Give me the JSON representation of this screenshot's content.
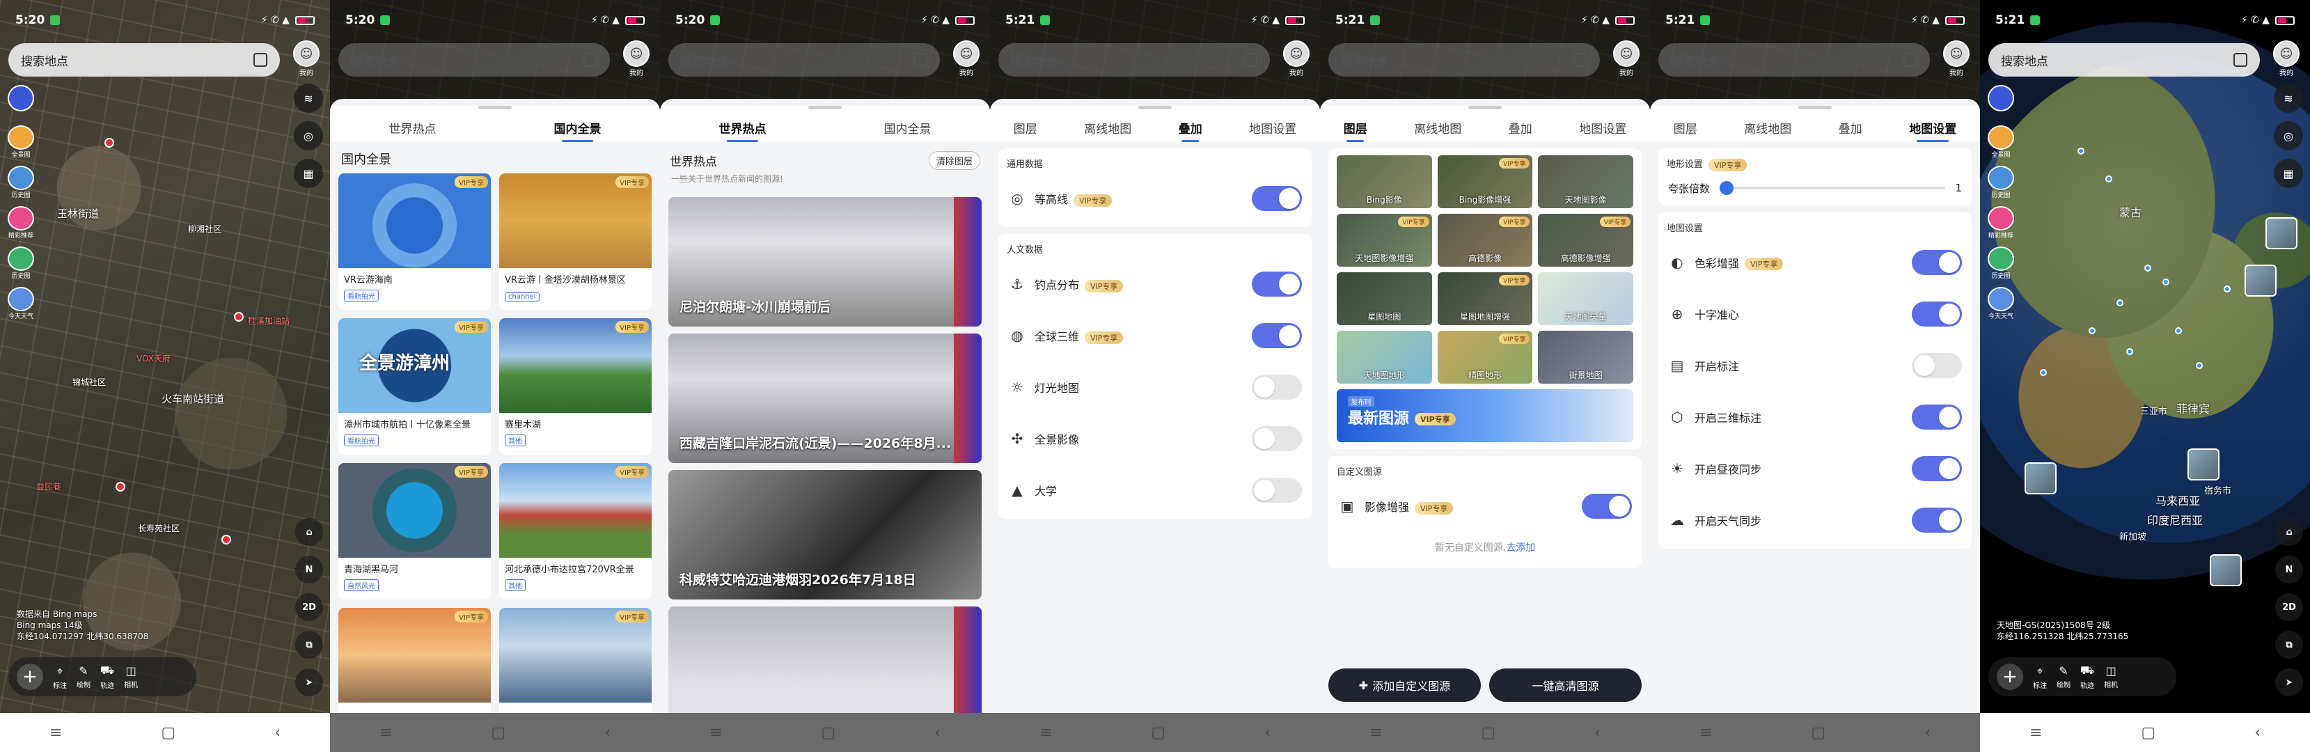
{
  "status": {
    "times": [
      "5:20",
      "5:20",
      "5:20",
      "5:21",
      "5:21",
      "5:21",
      "5:21"
    ]
  },
  "map": {
    "search_placeholder": "搜索地点",
    "avatar_label": "我的",
    "left_items": [
      "",
      "全景图",
      "历史图",
      "精彩推荐",
      "历史图",
      "今天天气"
    ],
    "right_items": [
      "图层",
      "探索",
      "工具"
    ],
    "right_bottom": [
      "2D",
      "图层",
      "定位"
    ],
    "labels_screen1": {
      "l1": "玉林街道",
      "l2": "柳湘社区",
      "l3": "火车南站街道",
      "l4": "锦城社区",
      "l5": "长寿苑社区",
      "l6": "桂溪加油站",
      "l7": "益民巷",
      "l8": "VOX天府"
    },
    "copyright1": [
      "数据来自 Bing maps",
      "Bing maps  14级",
      "东经104.071297  北纬30.638708"
    ],
    "tools": [
      {
        "label": "标注",
        "icon": "pin-icon"
      },
      {
        "label": "绘制",
        "icon": "draw-icon"
      },
      {
        "label": "轨迹",
        "icon": "track-icon"
      },
      {
        "label": "相机",
        "icon": "camera-icon"
      }
    ]
  },
  "panel_pano": {
    "tabs": [
      "世界热点",
      "国内全景"
    ],
    "active_tab": 1,
    "section": "国内全景",
    "vip": "VIP专享",
    "cards": [
      {
        "title": "VR云游海南",
        "tag": "看航拍光"
      },
      {
        "title": "VR云游丨金塔沙漠胡杨林景区",
        "tag": "channel"
      },
      {
        "title": "漳州市城市航拍丨十亿像素全景",
        "tag": "看航拍光"
      },
      {
        "title": "赛里木湖",
        "tag": "其他"
      },
      {
        "title": "青海湖黑马河",
        "tag": "自然风光"
      },
      {
        "title": "河北承德小布达拉宫720VR全景",
        "tag": "其他"
      },
      {
        "title": "",
        "tag": ""
      },
      {
        "title": "",
        "tag": ""
      }
    ],
    "card3_overlay": "全景游漳州"
  },
  "panel_hot": {
    "tabs": [
      "世界热点",
      "国内全景"
    ],
    "active_tab": 0,
    "title": "世界热点",
    "clear": "清除图层",
    "subtitle": "一些关于世界热点新闻的图源!",
    "items": [
      "尼泊尔朗塘-冰川崩塌前后",
      "西藏吉隆口岸泥石流(近景)——2026年8月...",
      "科威特艾哈迈迪港烟羽2026年7月18日",
      ""
    ]
  },
  "panel_overlay": {
    "tabs": [
      "图层",
      "离线地图",
      "叠加",
      "地图设置"
    ],
    "active_tab": 2,
    "groups": [
      {
        "title": "通用数据",
        "rows": [
          {
            "label": "等高线",
            "icon": "contour-icon",
            "vip": true,
            "on": true
          }
        ]
      },
      {
        "title": "人文数据",
        "rows": [
          {
            "label": "钓点分布",
            "icon": "fishing-icon",
            "vip": true,
            "on": true
          },
          {
            "label": "全球三维",
            "icon": "globe-icon",
            "vip": true,
            "on": true
          },
          {
            "label": "灯光地图",
            "icon": "light-icon",
            "vip": false,
            "on": false
          },
          {
            "label": "全景影像",
            "icon": "panorama-icon",
            "vip": false,
            "on": false
          },
          {
            "label": "大学",
            "icon": "school-icon",
            "vip": false,
            "on": false
          }
        ]
      }
    ],
    "vip": "VIP专享"
  },
  "panel_layers": {
    "tabs": [
      "图层",
      "离线地图",
      "叠加",
      "地图设置"
    ],
    "active_tab": 0,
    "layers": [
      {
        "name": "Bing影像",
        "vip": false
      },
      {
        "name": "Bing影像增强",
        "vip": true
      },
      {
        "name": "天地图影像",
        "vip": false
      },
      {
        "name": "天地图影像增强",
        "vip": true
      },
      {
        "name": "高德影像",
        "vip": true
      },
      {
        "name": "高德影像增强",
        "vip": true
      },
      {
        "name": "星图地图",
        "vip": false
      },
      {
        "name": "星图地图增强",
        "vip": true
      },
      {
        "name": "天地图矢量",
        "vip": false
      },
      {
        "name": "天地图地形",
        "vip": false
      },
      {
        "name": "晴图地形",
        "vip": true
      },
      {
        "name": "街景地图",
        "vip": false
      }
    ],
    "banner_label": "发布时",
    "banner_title": "最新图源",
    "vip": "VIP专享",
    "custom_title": "自定义图源",
    "custom_row": "影像增强",
    "empty_text": "暂无自定义图源,",
    "add_link": "去添加",
    "btn_add": "添加自定义图源",
    "btn_hd": "一键高清图源"
  },
  "panel_settings": {
    "tabs": [
      "图层",
      "离线地图",
      "叠加",
      "地图设置"
    ],
    "active_tab": 3,
    "terrain_title": "地形设置",
    "vip": "VIP专享",
    "slider_label": "夸张倍数",
    "slider_value": "1",
    "map_title": "地图设置",
    "rows": [
      {
        "label": "色彩增强",
        "icon": "color-icon",
        "vip": true,
        "on": true
      },
      {
        "label": "十字准心",
        "icon": "crosshair-icon",
        "vip": false,
        "on": true
      },
      {
        "label": "开启标注",
        "icon": "label-icon",
        "vip": false,
        "on": false
      },
      {
        "label": "开启三维标注",
        "icon": "cube-icon",
        "vip": false,
        "on": true
      },
      {
        "label": "开启昼夜同步",
        "icon": "sun-icon",
        "vip": false,
        "on": true
      },
      {
        "label": "开启天气同步",
        "icon": "weather-icon",
        "vip": false,
        "on": true
      }
    ]
  },
  "globe": {
    "labels": [
      "蒙古",
      "三亚市",
      "马来西亚",
      "印度尼西亚",
      "菲律宾",
      "宿务市",
      "新加坡"
    ],
    "copyright": [
      "天地图-GS(2025)1508号  2级",
      "东经116.251328  北纬25.773165"
    ]
  }
}
